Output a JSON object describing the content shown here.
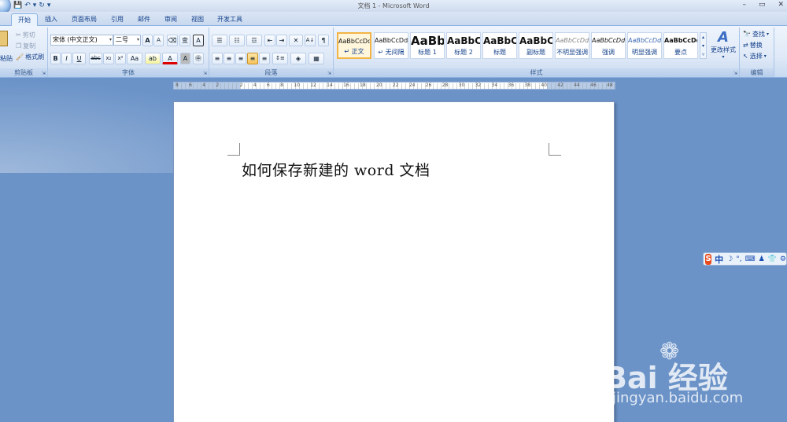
{
  "window": {
    "title": "文档 1 - Microsoft Word",
    "minimize": "–",
    "maximize": "▭",
    "close": "✕"
  },
  "qat": {
    "save_icon": "💾",
    "undo_icon": "↶",
    "undo_dd": "▾",
    "redo_icon": "↻",
    "customize_icon": "▾"
  },
  "tabs": [
    "开始",
    "插入",
    "页面布局",
    "引用",
    "邮件",
    "审阅",
    "视图",
    "开发工具"
  ],
  "clipboard": {
    "paste_label": "粘贴",
    "cut_label": "剪切",
    "copy_label": "复制",
    "format_painter_label": "格式刷",
    "group_label": "剪贴板"
  },
  "font": {
    "name_value": "宋体 (中文正文)",
    "size_value": "二号",
    "grow": "A",
    "shrink": "A",
    "clear": "⌫",
    "phonetic": "变",
    "border_char": "A",
    "bold": "B",
    "italic": "I",
    "underline": "U",
    "strike": "abc",
    "subscript": "x₂",
    "superscript": "x²",
    "change_case": "Aa",
    "highlight": "ab",
    "font_color": "A",
    "char_shade": "A",
    "enclose": "㊥",
    "group_label": "字体"
  },
  "paragraph": {
    "bullets": "☰",
    "numbering": "☷",
    "multilevel": "☲",
    "decrease_indent": "⇤",
    "increase_indent": "⇥",
    "chinese_layout": "✕",
    "sort": "A↓",
    "show_marks": "¶",
    "align_left": "≡",
    "align_center": "≡",
    "align_right": "≡",
    "justify": "≡",
    "distributed": "≡",
    "line_spacing": "↕≡",
    "shading": "◈",
    "borders": "▦",
    "group_label": "段落"
  },
  "styles": {
    "tiles": [
      {
        "sample": "AaBbCcDd",
        "name": "↵ 正文"
      },
      {
        "sample": "AaBbCcDd",
        "name": "↵ 无间隔"
      },
      {
        "sample": "AaBb",
        "name": "标题 1"
      },
      {
        "sample": "AaBbC",
        "name": "标题 2"
      },
      {
        "sample": "AaBbC",
        "name": "标题"
      },
      {
        "sample": "AaBbC",
        "name": "副标题"
      },
      {
        "sample": "AaBbCcDd",
        "name": "不明显强调"
      },
      {
        "sample": "AaBbCcDd",
        "name": "强调"
      },
      {
        "sample": "AaBbCcDd",
        "name": "明显强调"
      },
      {
        "sample": "AaBbCcDd",
        "name": "要点"
      }
    ],
    "change_styles_label": "更改样式",
    "group_label": "样式"
  },
  "editing": {
    "find_label": "查找",
    "replace_label": "替换",
    "select_label": "选择",
    "group_label": "编辑"
  },
  "ruler": {
    "numbers": [
      "8",
      "6",
      "4",
      "2",
      "",
      "2",
      "4",
      "6",
      "8",
      "10",
      "12",
      "14",
      "16",
      "18",
      "20",
      "22",
      "24",
      "26",
      "28",
      "30",
      "32",
      "34",
      "36",
      "38",
      "40",
      "42",
      "44",
      "46",
      "48"
    ]
  },
  "document": {
    "text": "如何保存新建的 word 文档"
  },
  "ime": {
    "logo": "S",
    "lang": "中",
    "icons": [
      "☽",
      "°,",
      "⌨",
      "♟",
      "👕",
      "⚙"
    ]
  },
  "watermark": {
    "text": "Bai 经验",
    "url": "jingyan.baidu.com"
  }
}
